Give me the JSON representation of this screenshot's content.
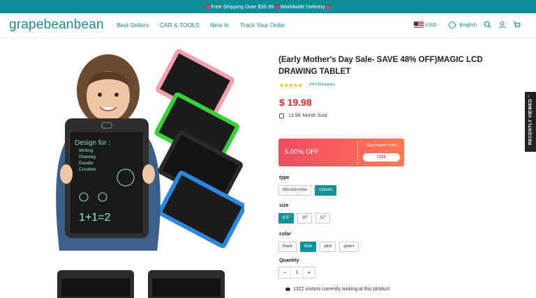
{
  "announcement": "💗Free Shipping Over $39.99💗Worldwide Delivery💗",
  "header": {
    "logo": "grapebeanbean",
    "nav": [
      "Best-Sellers",
      "CAR & TOOLS",
      "New In",
      "Track Your Order"
    ],
    "currency": "USD",
    "language": "English"
  },
  "product": {
    "title": "(Early Mother's Day Sale- SAVE 48% OFF)MAGIC LCD DRAWING TABLET",
    "rating_stars": "★★★★★",
    "reviews": "200 Reviews",
    "price": "$ 19.98",
    "sold": "13.5K Month Sold"
  },
  "coupon": {
    "discount": "5.00% OFF",
    "get_label": "Get coupon code",
    "code": "CD5"
  },
  "options": {
    "type": {
      "label": "type",
      "values": [
        "Monochrome",
        "colours"
      ],
      "selected": 1
    },
    "size": {
      "label": "size",
      "values": [
        "8.5\"",
        "10\"",
        "12\""
      ],
      "selected": 0
    },
    "color": {
      "label": "color",
      "values": [
        "black",
        "blue",
        "pink",
        "green"
      ],
      "selected": 1
    }
  },
  "quantity": {
    "label": "Quantity",
    "minus": "−",
    "value": "1",
    "plus": "+"
  },
  "visitors": "1322 visitors currently looking at this product",
  "recently_viewed": "RECENTLY VIEWED",
  "tablet_text": {
    "heading": "Design for :",
    "items": [
      "Writing",
      "Drawing",
      "Doodle",
      "Creative"
    ],
    "equation": "1+1=2"
  },
  "colors": {
    "accent": "#12939b",
    "price": "#e3262b",
    "coupon_start": "#f04a62",
    "coupon_end": "#ff7a55"
  }
}
